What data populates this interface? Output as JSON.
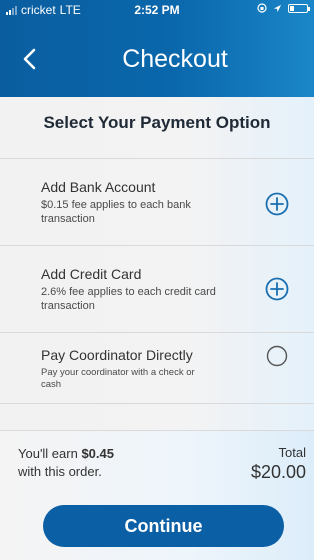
{
  "status_bar": {
    "carrier": "cricket",
    "network": "LTE",
    "time": "2:52 PM",
    "battery_level": 0.25
  },
  "header": {
    "title": "Checkout",
    "back_icon": "chevron-left-icon"
  },
  "section_title": "Select Your Payment Option",
  "options": [
    {
      "title": "Add Bank Account",
      "description": "$0.15 fee applies to each bank transaction",
      "icon": "plus-circle-icon"
    },
    {
      "title": "Add Credit Card",
      "description": "2.6% fee applies to each credit card transaction",
      "icon": "plus-circle-icon"
    },
    {
      "title": "Pay Coordinator Directly",
      "description": "Pay your coordinator with a check or cash",
      "icon": "radio-unselected"
    }
  ],
  "footer": {
    "earn_prefix": "You'll earn ",
    "earn_amount": "$0.45",
    "earn_suffix": "with this order.",
    "total_label": "Total",
    "total_value": "$20.00"
  },
  "continue_label": "Continue",
  "colors": {
    "primary": "#0b5fa5",
    "header": "#0a63a6",
    "accent_icon": "#1a6fb0"
  }
}
